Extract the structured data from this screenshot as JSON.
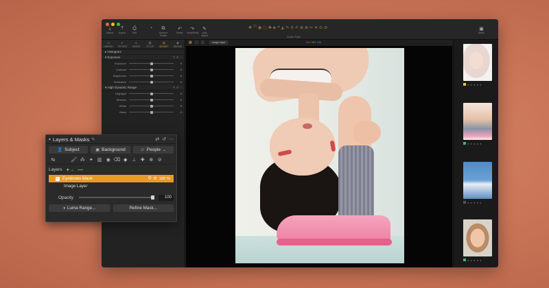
{
  "toolbar": {
    "tools": [
      {
        "icon": "⤓",
        "label": "Import"
      },
      {
        "icon": "⤒",
        "label": "Export"
      },
      {
        "icon": "⎙",
        "label": "Edit"
      },
      {
        "icon": "◔",
        "label": ""
      },
      {
        "icon": "⧉",
        "label": "Show in Finder"
      },
      {
        "icon": "↶",
        "label": "Reset"
      },
      {
        "icon": "↷",
        "label": "Undo/Redo"
      },
      {
        "icon": "✎",
        "label": "Auto Adjust"
      }
    ],
    "cursor_label": "Cursor Tools",
    "center_icons": [
      "✥",
      "⤧",
      "◉",
      "⬚",
      "✚",
      "⬖",
      "⌖",
      "◭",
      "✎",
      "⚲",
      "✐",
      "⊕",
      "⊗",
      "✂",
      "✦",
      "⊙",
      "⊘"
    ],
    "right_tool": {
      "icon": "▣",
      "label": "Batch"
    },
    "traffic_colors": [
      "#ff5f57",
      "#febc2e",
      "#28c840"
    ]
  },
  "left_panel": {
    "tabs": [
      {
        "icon": "▭",
        "label": "LIBRARY"
      },
      {
        "icon": "◐",
        "label": "TETHER"
      },
      {
        "icon": "◇",
        "label": "SHAPE"
      },
      {
        "icon": "◍",
        "label": "STYLE"
      },
      {
        "icon": "◎",
        "label": "ADJUST"
      },
      {
        "icon": "◈",
        "label": "REFINE"
      }
    ],
    "active_tab": "ADJUST",
    "histogram": "Histogram",
    "exposure": {
      "title": "Exposure",
      "sliders": [
        {
          "name": "Exposure",
          "value": "0"
        },
        {
          "name": "Contrast",
          "value": "0"
        },
        {
          "name": "Brightness",
          "value": "0"
        },
        {
          "name": "Saturation",
          "value": "0"
        }
      ]
    },
    "hdr": {
      "title": "High Dynamic Range",
      "sliders": [
        {
          "name": "Highlight",
          "value": "0"
        },
        {
          "name": "Shadow",
          "value": "0"
        },
        {
          "name": "White",
          "value": "0"
        },
        {
          "name": "Black",
          "value": "0"
        }
      ]
    }
  },
  "viewer": {
    "layer_label": "Image Layer",
    "rgb": {
      "r": "257",
      "g": "257",
      "b": "256"
    }
  },
  "filmstrip": {
    "thumbs": [
      {
        "tag_color": "#e8c341"
      },
      {
        "tag_color": "#45b56b"
      },
      {
        "tag_color": "#555555"
      },
      {
        "tag_color": "#45b56b"
      }
    ],
    "dots": "● ● ● ● ●"
  },
  "layers_panel": {
    "title": "Layers & Masks",
    "subject": "Subject",
    "background": "Background",
    "people": "People",
    "layers_label": "Layers",
    "selected_layer": "Eyebrows Mask",
    "selected_opacity": "100 %",
    "image_layer": "Image Layer",
    "opacity_label": "Opacity",
    "opacity_value": "100",
    "opacity_level": 1.0,
    "luma_range": "Luma Range...",
    "refine_mask": "Refine Mask..."
  }
}
